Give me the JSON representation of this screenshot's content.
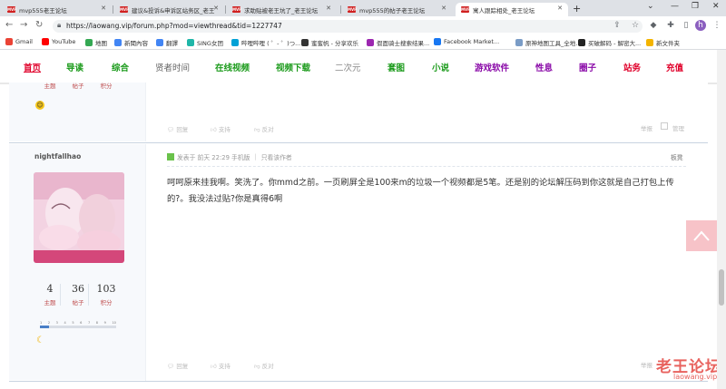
{
  "browser": {
    "tabs": [
      {
        "label": "mvp555老王论坛",
        "favicon": "MVP"
      },
      {
        "label": "建议&投诉&申诉区站务区_老王",
        "favicon": "MVP"
      },
      {
        "label": "求助贴被老王坑了_老王论坛",
        "favicon": "MVP"
      },
      {
        "label": "mvp555的帖子老王论坛",
        "favicon": "MVP"
      },
      {
        "label": "寓人跟踪相处_老王论坛",
        "favicon": "MVP"
      }
    ],
    "active_tab": 4,
    "url": "https://laowang.vip/forum.php?mod=viewthread&tid=1227747",
    "profile_initial": "h"
  },
  "bookmarks": [
    {
      "label": "Gmail",
      "color": "#ea4335"
    },
    {
      "label": "YouTube",
      "color": "#ff0000"
    },
    {
      "label": "地图",
      "color": "#34a853"
    },
    {
      "label": "新聞內容",
      "color": "#4285f4"
    },
    {
      "label": "翻譯",
      "color": "#4285f4"
    },
    {
      "label": "SING女团",
      "color": "#1fb6a8"
    },
    {
      "label": "哔哩哔哩 ( ゜- ゜)つ...",
      "color": "#00a1d6"
    },
    {
      "label": "蜜蜜帆 - 分享欢乐",
      "color": "#333333"
    },
    {
      "label": "假面骑士搜索结果...",
      "color": "#9c27b0"
    },
    {
      "label": "Facebook Market...",
      "color": "#1877f2"
    },
    {
      "label": "原神地图工具_全地...",
      "color": "#7a9cc6"
    },
    {
      "label": "买破解码 - 解密大...",
      "color": "#222222"
    },
    {
      "label": "新文件夹",
      "color": "#f4b400"
    }
  ],
  "site_nav": [
    {
      "label": "首页",
      "color": "#e0002a"
    },
    {
      "label": "导读",
      "color": "#1a9a1a"
    },
    {
      "label": "综合",
      "color": "#1a9a1a"
    },
    {
      "label": "贤者时间",
      "color": "#666666"
    },
    {
      "label": "在线视频",
      "color": "#1a9a1a"
    },
    {
      "label": "视频下载",
      "color": "#1a9a1a"
    },
    {
      "label": "二次元",
      "color": "#888888"
    },
    {
      "label": "套图",
      "color": "#1a9a1a"
    },
    {
      "label": "小说",
      "color": "#1a9a1a"
    },
    {
      "label": "游戏软件",
      "color": "#8a0aa8"
    },
    {
      "label": "性息",
      "color": "#8a0aa8"
    },
    {
      "label": "圈子",
      "color": "#8a0aa8"
    },
    {
      "label": "站务",
      "color": "#e0002a"
    },
    {
      "label": "充值",
      "color": "#e0002a"
    }
  ],
  "prev_post": {
    "stats_labels": [
      "主题",
      "帖子",
      "积分"
    ],
    "actions": [
      "回复",
      "支持",
      "反对"
    ],
    "right_actions": [
      "举报",
      "管理"
    ]
  },
  "post": {
    "author": "nightfallhao",
    "meta_prefix": "发表于 前天 22:29 手机版",
    "meta_author_only": "只看该作者",
    "floor": "板凳",
    "body": "呵呵原来挂我啊。笑洗了。你mmd之前。一页刷屏全是100来m的垃圾一个视频都是5笔。还是别的论坛解压码到你这就是自己打包上传的?。我没法过贴?你是真得6啊",
    "stats": [
      {
        "value": "4",
        "label": "主题"
      },
      {
        "value": "36",
        "label": "帖子"
      },
      {
        "value": "103",
        "label": "积分"
      }
    ],
    "level_ticks": [
      "1",
      "2",
      "3",
      "4",
      "5",
      "6",
      "7",
      "8",
      "9",
      "10"
    ],
    "actions": [
      "回复",
      "支持",
      "反对"
    ],
    "right_actions": [
      "举报"
    ]
  },
  "watermark": {
    "title": "老王论坛",
    "domain": "laowang.vip"
  }
}
